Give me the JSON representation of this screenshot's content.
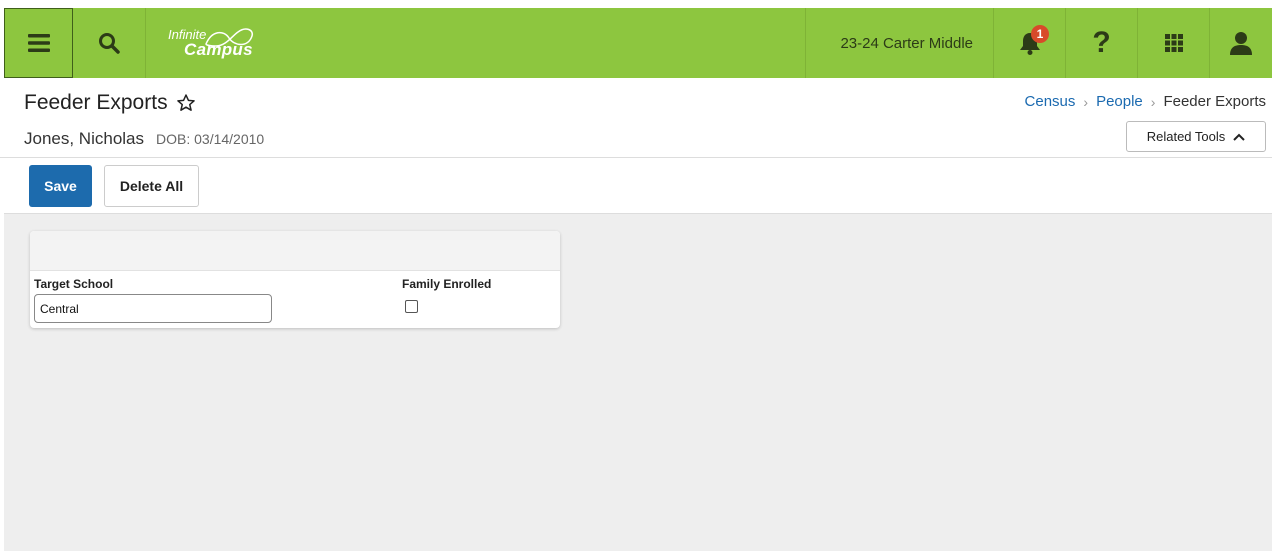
{
  "app": {
    "logo_line1": "Infinite",
    "logo_line2": "Campus",
    "school_year": "23-24 Carter Middle",
    "notification_count": "1",
    "help_glyph": "?"
  },
  "header": {
    "title": "Feeder Exports",
    "breadcrumb": [
      "Census",
      "People",
      "Feeder Exports"
    ],
    "person_name": "Jones, Nicholas",
    "dob": "DOB: 03/14/2010",
    "related_tools_label": "Related Tools"
  },
  "toolbar": {
    "save_label": "Save",
    "delete_all_label": "Delete All"
  },
  "form": {
    "target_school_label": "Target School",
    "target_school_value": "Central",
    "family_enrolled_label": "Family Enrolled",
    "family_enrolled_checked": false
  },
  "colors": {
    "brand_green": "#8dc63f",
    "primary_blue": "#1d6bad",
    "link_blue": "#1b6ab0",
    "badge_red": "#d84a2a"
  },
  "icons": [
    "hamburger-menu-icon",
    "search-icon",
    "bell-icon",
    "help-icon",
    "apps-grid-icon",
    "user-icon",
    "star-outline-icon",
    "chevron-up-icon",
    "chevron-right-icon"
  ]
}
